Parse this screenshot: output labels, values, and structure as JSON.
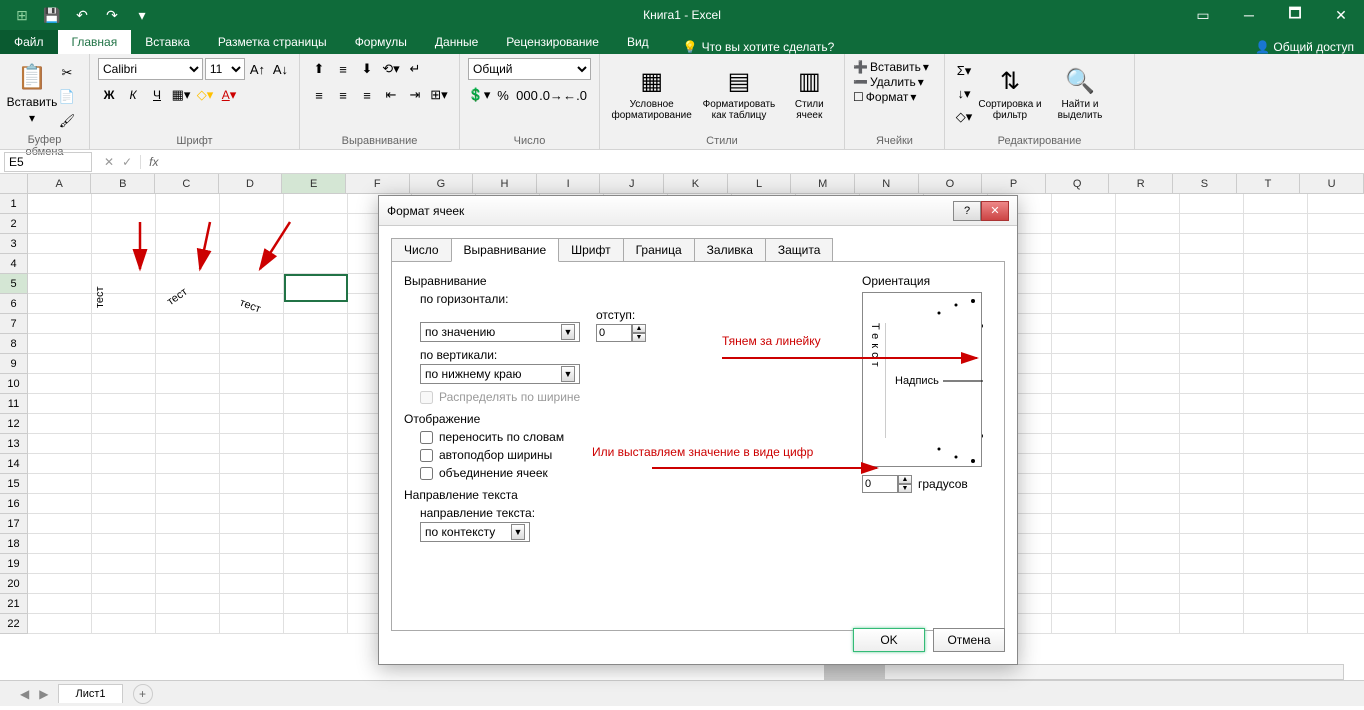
{
  "app": {
    "title": "Книга1 - Excel",
    "share": "Общий доступ"
  },
  "qat": {
    "save": "💾",
    "undo": "↶",
    "redo": "↷",
    "touch": "☝"
  },
  "tabs": {
    "file": "Файл",
    "home": "Главная",
    "insert": "Вставка",
    "layout": "Разметка страницы",
    "formulas": "Формулы",
    "data": "Данные",
    "review": "Рецензирование",
    "view": "Вид",
    "tell": "Что вы хотите сделать?"
  },
  "ribbon": {
    "clipboard": {
      "label": "Буфер обмена",
      "paste": "Вставить"
    },
    "font": {
      "label": "Шрифт",
      "name": "Calibri",
      "size": "11"
    },
    "align": {
      "label": "Выравнивание"
    },
    "number": {
      "label": "Число",
      "format": "Общий"
    },
    "styles": {
      "label": "Стили",
      "cond": "Условное форматирование",
      "table": "Форматировать как таблицу",
      "cell": "Стили ячеек"
    },
    "cells": {
      "label": "Ячейки",
      "insert": "Вставить",
      "delete": "Удалить",
      "format": "Формат"
    },
    "editing": {
      "label": "Редактирование",
      "sort": "Сортировка и фильтр",
      "find": "Найти и выделить"
    }
  },
  "namebox": "E5",
  "columns": [
    "A",
    "B",
    "C",
    "D",
    "E",
    "F",
    "G",
    "H",
    "I",
    "J",
    "K",
    "L",
    "M",
    "N",
    "O",
    "P",
    "Q",
    "R",
    "S",
    "T",
    "U"
  ],
  "cell_text": {
    "b5": "тест",
    "c5": "тест",
    "d5": "тест"
  },
  "sheet": "Лист1",
  "dialog": {
    "title": "Формат ячеек",
    "tabs": {
      "number": "Число",
      "align": "Выравнивание",
      "font": "Шрифт",
      "border": "Граница",
      "fill": "Заливка",
      "protect": "Защита"
    },
    "align_section": "Выравнивание",
    "horiz_label": "по горизонтали:",
    "horiz_value": "по значению",
    "indent_label": "отступ:",
    "indent_value": "0",
    "vert_label": "по вертикали:",
    "vert_value": "по нижнему краю",
    "distribute": "Распределять по ширине",
    "display_section": "Отображение",
    "wrap": "переносить по словам",
    "shrink": "автоподбор ширины",
    "merge": "объединение ячеек",
    "textdir_section": "Направление текста",
    "textdir_label": "направление текста:",
    "textdir_value": "по контексту",
    "orient_label": "Ориентация",
    "orient_text": "Текст",
    "orient_caption": "Надпись",
    "degrees_value": "0",
    "degrees_label": "градусов",
    "ok": "OK",
    "cancel": "Отмена"
  },
  "annotations": {
    "pull": "Тянем за линейку",
    "digits": "Или выставляем значение в виде цифр"
  }
}
